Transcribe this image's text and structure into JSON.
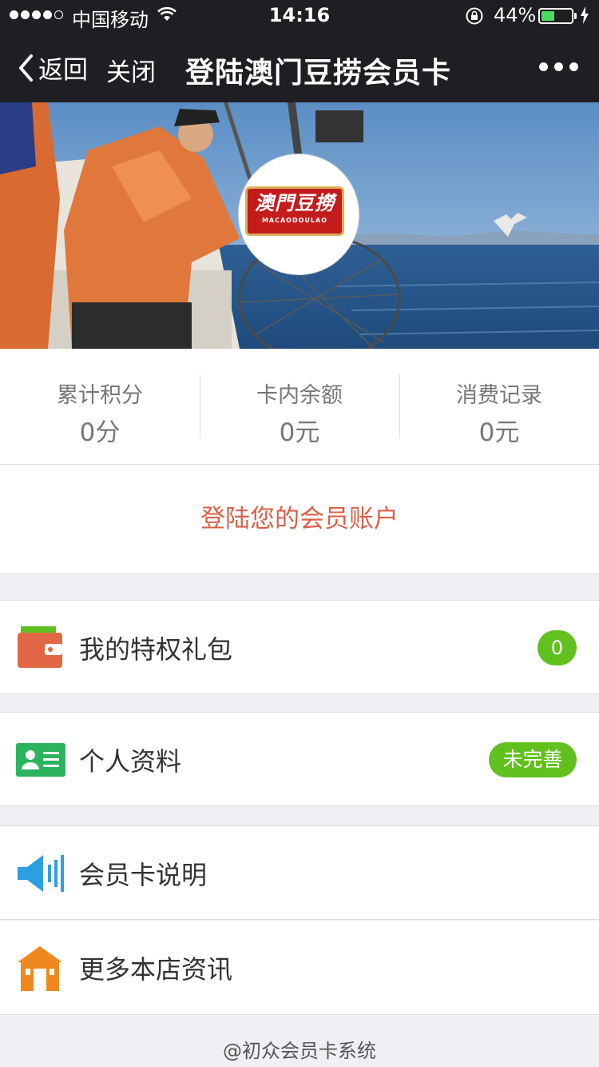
{
  "status_bar": {
    "carrier": "中国移动",
    "time": "14:16",
    "battery_percent": "44%",
    "battery_level": 0.44
  },
  "nav": {
    "back_label": "返回",
    "close_label": "关闭",
    "title": "登陆澳门豆捞会员卡"
  },
  "logo": {
    "text_zh": "澳門豆撈",
    "text_en": "MACAODOULAO",
    "brand_red": "#c41b1b"
  },
  "stats": [
    {
      "label": "累计积分",
      "value": "0分"
    },
    {
      "label": "卡内余额",
      "value": "0元"
    },
    {
      "label": "消费记录",
      "value": "0元"
    }
  ],
  "login_label": "登陆您的会员账户",
  "menu": {
    "privileges": {
      "label": "我的特权礼包",
      "badge": "0",
      "icon": "wallet-icon"
    },
    "profile": {
      "label": "个人资料",
      "badge": "未完善",
      "icon": "id-card-icon"
    },
    "card_info": {
      "label": "会员卡说明",
      "icon": "speaker-icon"
    },
    "store_news": {
      "label": "更多本店资讯",
      "icon": "store-icon"
    }
  },
  "footer": "@初众会员卡系统",
  "colors": {
    "accent_green": "#62c01e",
    "login_text": "#d9614a",
    "nav_bg": "#1f1f23"
  }
}
